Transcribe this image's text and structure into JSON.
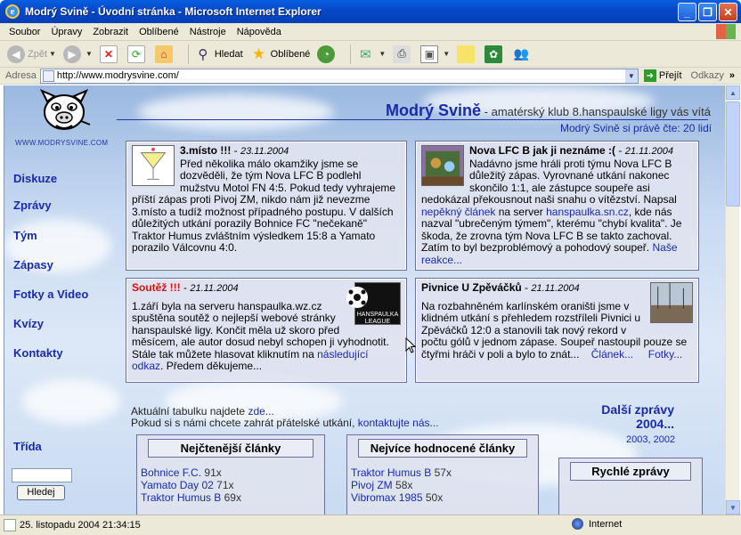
{
  "window": {
    "title": "Modrý Svině - Úvodní stránka - Microsoft Internet Explorer",
    "buttons": [
      "_",
      "❐",
      "✕"
    ]
  },
  "menu": [
    "Soubor",
    "Úpravy",
    "Zobrazit",
    "Oblíbené",
    "Nástroje",
    "Nápověda"
  ],
  "toolbar": {
    "back": "Zpět",
    "search": "Hledat",
    "favorites": "Oblíbené"
  },
  "address": {
    "label": "Adresa",
    "url": "http://www.modrysvine.com/",
    "go": "Přejít",
    "links": "Odkazy"
  },
  "site": {
    "logo_url": "WWW.MODRYSVINE.COM",
    "name": "Modrý Svině",
    "tagline": " - amatérský klub 8.hanspaulské ligy vás vítá",
    "readers": "Modrý Svině si právě čte: 20 lidí"
  },
  "nav": [
    "Diskuze",
    "Zprávy",
    "Tým",
    "Zápasy",
    "Fotky a Video",
    "Kvízy",
    "Kontakty"
  ],
  "articles": [
    {
      "title": "3.místo !!!",
      "date": "23.11.2004",
      "text": "Před několika málo okamžiky jsme se dozvěděli, že tým Nova LFC B podlehl mužstvu Motol FN 4:5. Pokud tedy vyhrajeme příští zápas proti Pivoj ZM, nikdo nám již nevezme 3.místo a tudíž možnost případného postupu. V dalších důležitých utkání porazily Bohnice FC \"nečekaně\" Traktor Humus zvláštním výsledkem 15:8 a Yamato porazilo Válcovnu 4:0."
    },
    {
      "title": "Nova LFC B jak ji neznáme :(",
      "date": "21.11.2004",
      "text1": "Nadávno jsme hráli proti týmu Nova LFC B důležitý zápas. Vyrovnané utkání nakonec skončilo 1:1, ale zástupce soupeře asi nedokázal překousnout naši snahu o vítězství. Napsal ",
      "link1": "nepěkný článek",
      "text2": " na server ",
      "link2": "hanspaulka.sn.cz",
      "text3": ", kde nás nazval \"ubrečeným týmem\", kterému \"chybí kvalita\". Je škoda, že zrovna tým Nova LFC B se takto zachoval. Zatím to byl bezproblémový a pohodový soupeř. ",
      "link3": "Naše reakce..."
    },
    {
      "title": "Soutěž !!!",
      "date": "21.11.2004",
      "thumb": "HANSPAULKA LEAGUE",
      "text1": "1.září byla na serveru hanspaulka.wz.cz spuštěna soutěž o nejlepší webové stránky hanspaulské ligy. Končit měla už skoro před měsícem, ale autor dosud nebyl schopen ji vyhodnotit. Stále tak můžete hlasovat kliknutím na ",
      "link1": "následující odkaz",
      "text2": ". Předem děkujeme..."
    },
    {
      "title": "Pivnice U Zpěváčků",
      "date": "21.11.2004",
      "text": "Na rozbahněném karlínském oraništi jsme v klidném utkání s přehledem rozstříleli Pivnici u Zpěváčků 12:0 a stanovili tak nový rekord v počtu gólů v jednom zápase. Soupeř nastoupil pouze se čtyřmi hráči v poli a bylo to znát...",
      "link1": "Článek...",
      "link2": "Fotky..."
    }
  ],
  "info": {
    "line1_text": "Aktuální tabulku najdete ",
    "line1_link": "zde...",
    "line2_text": "Pokud si s námi chcete zahrát přátelské utkání, ",
    "line2_link": "kontaktujte nás..."
  },
  "more_news": {
    "line1": "Další zprávy",
    "line2": "2004...",
    "years": "2003, 2002"
  },
  "sidebar_search": {
    "label": "Třída",
    "button": "Hledej"
  },
  "most_read": {
    "title": "Nejčtenější články",
    "rows": [
      {
        "name": "Bohnice F.C.",
        "count": "91x"
      },
      {
        "name": "Yamato Day 02",
        "count": "71x"
      },
      {
        "name": "Traktor Humus B",
        "count": "69x"
      }
    ]
  },
  "top_rated": {
    "title": "Nejvíce hodnocené články",
    "rows": [
      {
        "name": "Traktor Humus B",
        "count": "57x"
      },
      {
        "name": "Pivoj ZM",
        "count": "58x"
      },
      {
        "name": "Vibromax 1985",
        "count": "50x"
      }
    ]
  },
  "quick_news": {
    "title": "Rychlé zprávy"
  },
  "status": {
    "text": "25. listopadu 2004 21:34:15",
    "zone": "Internet"
  }
}
